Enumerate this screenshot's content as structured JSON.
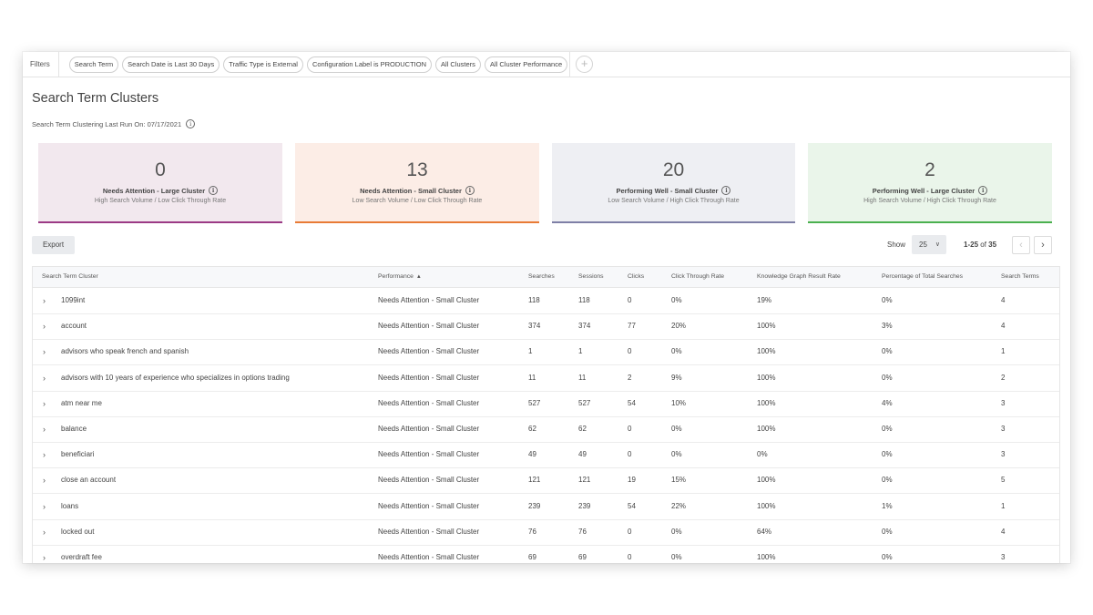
{
  "filters": {
    "label": "Filters",
    "chips": [
      "Search Term",
      "Search Date is Last 30 Days",
      "Traffic Type is External",
      "Configuration Label is PRODUCTION",
      "All Clusters",
      "All Cluster Performance"
    ],
    "add_icon": "+"
  },
  "page": {
    "title": "Search Term Clusters",
    "last_run": "Search Term Clustering Last Run On: 07/17/2021"
  },
  "cards": [
    {
      "count": "0",
      "title": "Needs Attention - Large Cluster",
      "subtitle": "High Search Volume / Low Click Through Rate",
      "bg": "#f2e8ee",
      "accent": "#9b3a85"
    },
    {
      "count": "13",
      "title": "Needs Attention - Small Cluster",
      "subtitle": "Low Search Volume / Low Click Through Rate",
      "bg": "#fcede6",
      "accent": "#e87b35"
    },
    {
      "count": "20",
      "title": "Performing Well - Small Cluster",
      "subtitle": "Low Search Volume / High Click Through Rate",
      "bg": "#eeeff3",
      "accent": "#7e7fa6"
    },
    {
      "count": "2",
      "title": "Performing Well - Large Cluster",
      "subtitle": "High Search Volume / High Click Through Rate",
      "bg": "#eaf5ea",
      "accent": "#4bb04f"
    }
  ],
  "toolbar": {
    "export_label": "Export",
    "show_label": "Show",
    "page_size": "25",
    "range": "1-25",
    "of_text": "of",
    "total": "35",
    "prev_icon": "‹",
    "next_icon": "›"
  },
  "table": {
    "columns": [
      "Search Term Cluster",
      "Performance",
      "Searches",
      "Sessions",
      "Clicks",
      "Click Through Rate",
      "Knowledge Graph Result Rate",
      "Percentage of Total Searches",
      "Search Terms"
    ],
    "sort_icon": "▲",
    "expand_icon": "›",
    "rows": [
      [
        "1099int",
        "Needs Attention - Small Cluster",
        "118",
        "118",
        "0",
        "0%",
        "19%",
        "0%",
        "4"
      ],
      [
        "account",
        "Needs Attention - Small Cluster",
        "374",
        "374",
        "77",
        "20%",
        "100%",
        "3%",
        "4"
      ],
      [
        "advisors who speak french and spanish",
        "Needs Attention - Small Cluster",
        "1",
        "1",
        "0",
        "0%",
        "100%",
        "0%",
        "1"
      ],
      [
        "advisors with 10 years of experience who specializes in options trading",
        "Needs Attention - Small Cluster",
        "11",
        "11",
        "2",
        "9%",
        "100%",
        "0%",
        "2"
      ],
      [
        "atm near me",
        "Needs Attention - Small Cluster",
        "527",
        "527",
        "54",
        "10%",
        "100%",
        "4%",
        "3"
      ],
      [
        "balance",
        "Needs Attention - Small Cluster",
        "62",
        "62",
        "0",
        "0%",
        "100%",
        "0%",
        "3"
      ],
      [
        "beneficiari",
        "Needs Attention - Small Cluster",
        "49",
        "49",
        "0",
        "0%",
        "0%",
        "0%",
        "3"
      ],
      [
        "close an account",
        "Needs Attention - Small Cluster",
        "121",
        "121",
        "19",
        "15%",
        "100%",
        "0%",
        "5"
      ],
      [
        "loans",
        "Needs Attention - Small Cluster",
        "239",
        "239",
        "54",
        "22%",
        "100%",
        "1%",
        "1"
      ],
      [
        "locked out",
        "Needs Attention - Small Cluster",
        "76",
        "76",
        "0",
        "0%",
        "64%",
        "0%",
        "4"
      ],
      [
        "overdraft fee",
        "Needs Attention - Small Cluster",
        "69",
        "69",
        "0",
        "0%",
        "100%",
        "0%",
        "3"
      ]
    ]
  }
}
